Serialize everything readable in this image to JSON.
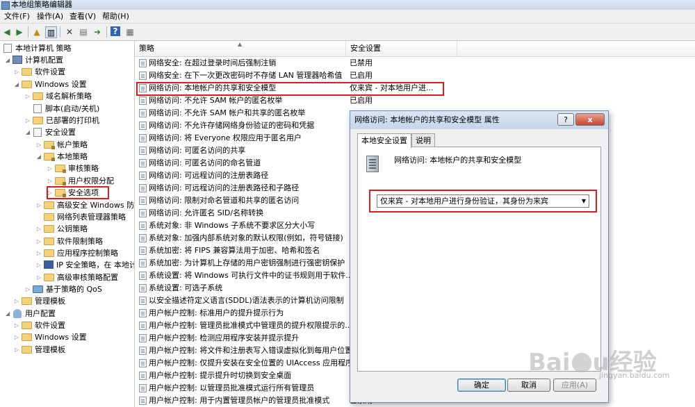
{
  "window": {
    "title": "本地组策略编辑器"
  },
  "menu": [
    "文件(F)",
    "操作(A)",
    "查看(V)",
    "帮助(H)"
  ],
  "tree": {
    "items": [
      {
        "label": "本地计算机 策略"
      },
      {
        "label": "计算机配置"
      },
      {
        "label": "软件设置"
      },
      {
        "label": "Windows 设置"
      },
      {
        "label": "域名解析策略"
      },
      {
        "label": "脚本(启动/关机)"
      },
      {
        "label": "已部署的打印机"
      },
      {
        "label": "安全设置"
      },
      {
        "label": "帐户策略"
      },
      {
        "label": "本地策略"
      },
      {
        "label": "审核策略"
      },
      {
        "label": "用户权限分配"
      },
      {
        "label": "安全选项"
      },
      {
        "label": "高级安全 Windows 防"
      },
      {
        "label": "网络列表管理器策略"
      },
      {
        "label": "公钥策略"
      },
      {
        "label": "软件限制策略"
      },
      {
        "label": "应用程序控制策略"
      },
      {
        "label": "IP 安全策略，在 本地计"
      },
      {
        "label": "高级审核策略配置"
      },
      {
        "label": "基于策略的 QoS"
      },
      {
        "label": "管理模板"
      },
      {
        "label": "用户配置"
      },
      {
        "label": "软件设置"
      },
      {
        "label": "Windows 设置"
      },
      {
        "label": "管理模板"
      }
    ]
  },
  "list": {
    "columns": [
      "策略",
      "安全设置"
    ],
    "rows": [
      {
        "policy": "网络安全: 在超过登录时间后强制注销",
        "setting": "已禁用"
      },
      {
        "policy": "网络安全: 在下一次更改密码时不存储 LAN 管理器哈希值",
        "setting": "已启用"
      },
      {
        "policy": "网络访问: 本地帐户的共享和安全模型",
        "setting": "仅来宾 - 对本地用户进..."
      },
      {
        "policy": "网络访问: 不允许 SAM 帐户的匿名枚举",
        "setting": "已启用"
      },
      {
        "policy": "网络访问: 不允许 SAM 帐户和共享的匿名枚举",
        "setting": ""
      },
      {
        "policy": "网络访问: 不允许存储网络身份验证的密码和凭据",
        "setting": ""
      },
      {
        "policy": "网络访问: 将 Everyone 权限应用于匿名用户",
        "setting": ""
      },
      {
        "policy": "网络访问: 可匿名访问的共享",
        "setting": ""
      },
      {
        "policy": "网络访问: 可匿名访问的命名管道",
        "setting": ""
      },
      {
        "policy": "网络访问: 可远程访问的注册表路径",
        "setting": ""
      },
      {
        "policy": "网络访问: 可远程访问的注册表路径和子路径",
        "setting": ""
      },
      {
        "policy": "网络访问: 限制对命名管道和共享的匿名访问",
        "setting": ""
      },
      {
        "policy": "网络访问: 允许匿名 SID/名称转换",
        "setting": ""
      },
      {
        "policy": "系统对象: 非 Windows 子系统不要求区分大小写",
        "setting": ""
      },
      {
        "policy": "系统对象: 加强内部系统对象的默认权限(例如，符号链接)",
        "setting": ""
      },
      {
        "policy": "系统加密: 将 FIPS 兼容算法用于加密、哈希和签名",
        "setting": ""
      },
      {
        "policy": "系统加密: 为计算机上存储的用户密钥强制进行强密钥保护",
        "setting": ""
      },
      {
        "policy": "系统设置: 将 Windows 可执行文件中的证书规则用于软件...",
        "setting": ""
      },
      {
        "policy": "系统设置: 可选子系统",
        "setting": ""
      },
      {
        "policy": "以安全描述符定义语言(SDDL)语法表示的计算机访问限制",
        "setting": ""
      },
      {
        "policy": "用户帐户控制: 标准用户的提升提示行为",
        "setting": ""
      },
      {
        "policy": "用户帐户控制: 管理员批准模式中管理员的提升权限提示的...",
        "setting": ""
      },
      {
        "policy": "用户帐户控制: 检测应用程序安装并提示提升",
        "setting": ""
      },
      {
        "policy": "用户帐户控制: 将文件和注册表写入错误虚拟化到每用户位置",
        "setting": ""
      },
      {
        "policy": "用户帐户控制: 仅提升安装在安全位置的 UIAccess 应用程序",
        "setting": ""
      },
      {
        "policy": "用户帐户控制: 提示提升时切换到安全桌面",
        "setting": ""
      },
      {
        "policy": "用户帐户控制: 以管理员批准模式运行所有管理员",
        "setting": ""
      },
      {
        "policy": "用户帐户控制: 用于内置管理员帐户的管理员批准模式",
        "setting": "已禁用"
      }
    ]
  },
  "dialog": {
    "title": "网络访问: 本地帐户的共享和安全模型 属性",
    "help_label": "?",
    "close_label": "x",
    "tabs": [
      "本地安全设置",
      "说明"
    ],
    "policy_name": "网络访问: 本地帐户的共享和安全模型",
    "selected_option": "仅来宾 - 对本地用户进行身份验证，其身份为来宾",
    "ok_label": "确定",
    "cancel_label": "取消",
    "apply_label": "应用(A)"
  },
  "watermark": {
    "brand": "Bai",
    "brand2": "u",
    "suffix": "经验",
    "sub": "jingyan.baidu.com"
  },
  "colors": {
    "highlight": "#e01a1a",
    "folder": "#f3d27a"
  }
}
